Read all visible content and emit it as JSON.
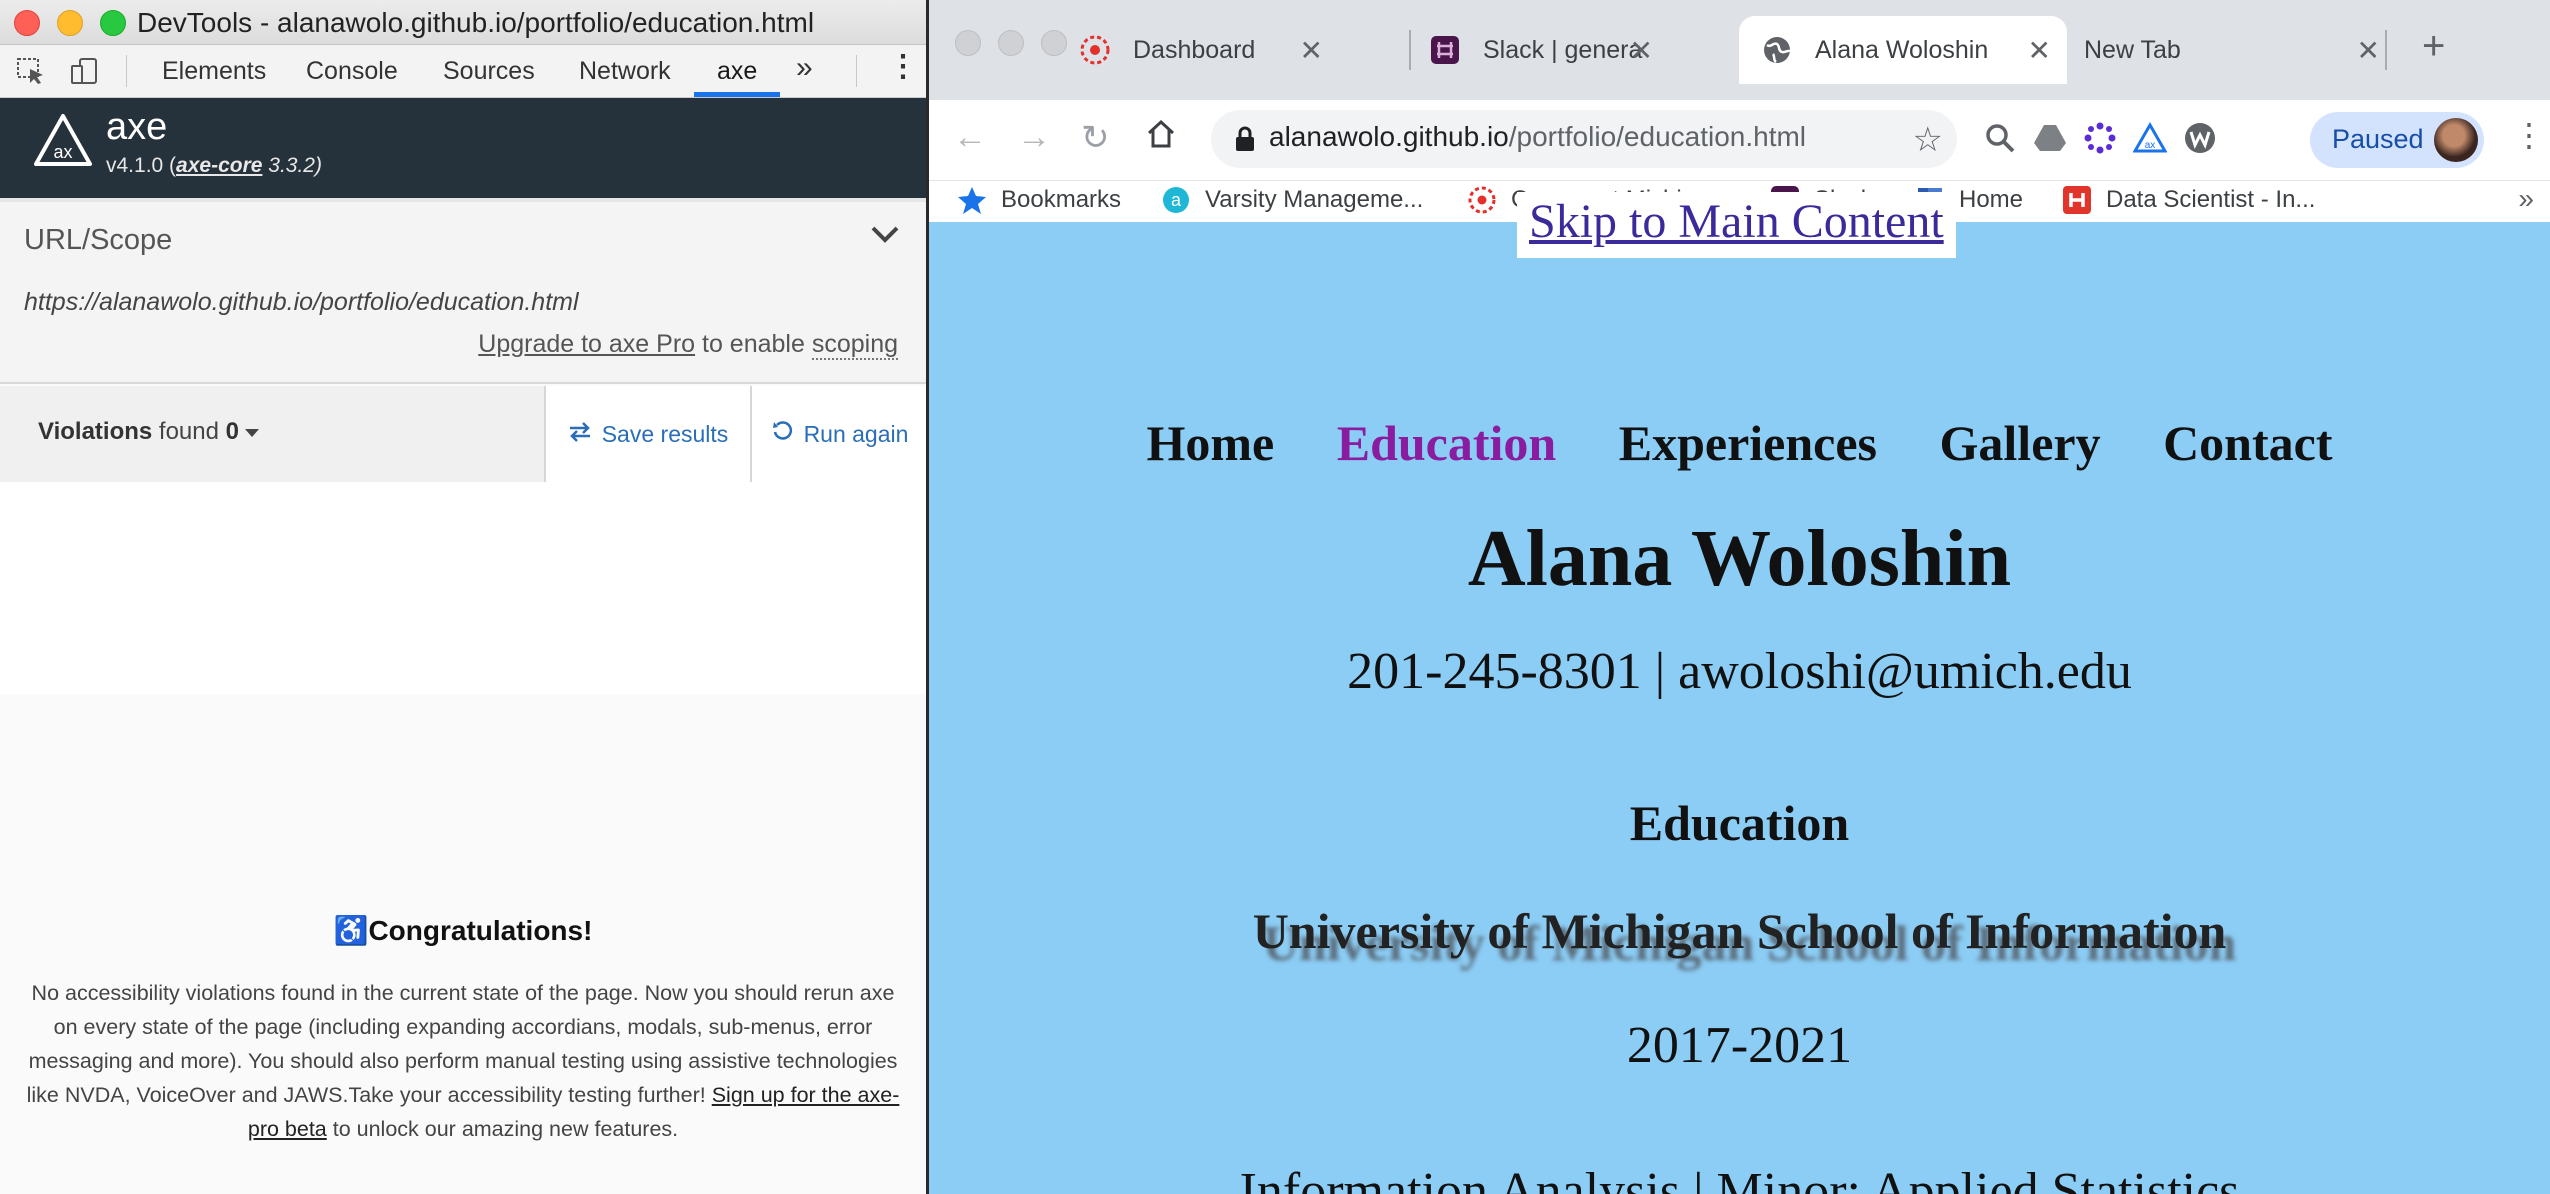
{
  "devtools": {
    "window_title": "DevTools - alanawolo.github.io/portfolio/education.html",
    "tabs": [
      "Elements",
      "Console",
      "Sources",
      "Network",
      "axe",
      "»"
    ],
    "active_tab": "axe",
    "axe": {
      "name": "axe",
      "version_prefix": "v4.1.0 (",
      "core_label": "axe-core",
      "core_version": " 3.3.2)",
      "scope_label": "URL/Scope",
      "scope_url": "https://alanawolo.github.io/portfolio/education.html",
      "upgrade_link": "Upgrade to axe Pro",
      "upgrade_middle": " to enable ",
      "upgrade_scoping": "scoping",
      "violations_label": "Violations",
      "violations_found": " found ",
      "violations_count": "0",
      "save_results": "Save results",
      "run_again": "Run again",
      "congrats_title": "Congratulations!",
      "congrats_body": "No accessibility violations found in the current state of the page. Now you should rerun axe on every state of the page (including expanding accordians, modals, sub-menus, error messaging and more). You should also perform manual testing using assistive technologies like NVDA, VoiceOver and JAWS.Take your accessibility testing further! ",
      "congrats_link": "Sign up for the axe-pro beta",
      "congrats_tail": " to unlock our amazing new features."
    }
  },
  "browser": {
    "tabs": [
      {
        "title": "Dashboard",
        "icon": "canvas-icon"
      },
      {
        "title": "Slack | general | S",
        "icon": "slack-icon"
      },
      {
        "title": "Alana Woloshin",
        "icon": "globe-icon",
        "active": true
      },
      {
        "title": "New Tab",
        "icon": "none"
      }
    ],
    "url_host": "alanawolo.github.io",
    "url_path": "/portfolio/education.html",
    "profile_status": "Paused",
    "bookmarks": [
      {
        "label": "Bookmarks",
        "icon": "star-icon"
      },
      {
        "label": "Varsity Manageme...",
        "icon": "varsity-icon"
      },
      {
        "label": "Canvas at Michigan",
        "icon": "canvas-icon"
      },
      {
        "label": "Slack",
        "icon": "slack-icon"
      },
      {
        "label": "Home",
        "icon": "home-bookmark-icon"
      },
      {
        "label": "Data Scientist - In...",
        "icon": "handshake-icon"
      }
    ],
    "bookmarks_more": "»"
  },
  "page": {
    "skip_link": "Skip to Main Content",
    "nav": [
      "Home",
      "Education",
      "Experiences",
      "Gallery",
      "Contact"
    ],
    "nav_current": "Education",
    "name": "Alana Woloshin",
    "contact": "201-245-8301 | awoloshi@umich.edu",
    "section_heading": "Education",
    "school": "University of Michigan School of Information",
    "years": "2017-2021",
    "major": "Information Analysis | Minor: Applied Statistics"
  },
  "colors": {
    "page_background": "#8ccdf5",
    "nav_current": "#8a1ca0",
    "axe_header": "#25313b",
    "axe_link": "#2a6eb8",
    "chrome_accent": "#1a73e8"
  }
}
